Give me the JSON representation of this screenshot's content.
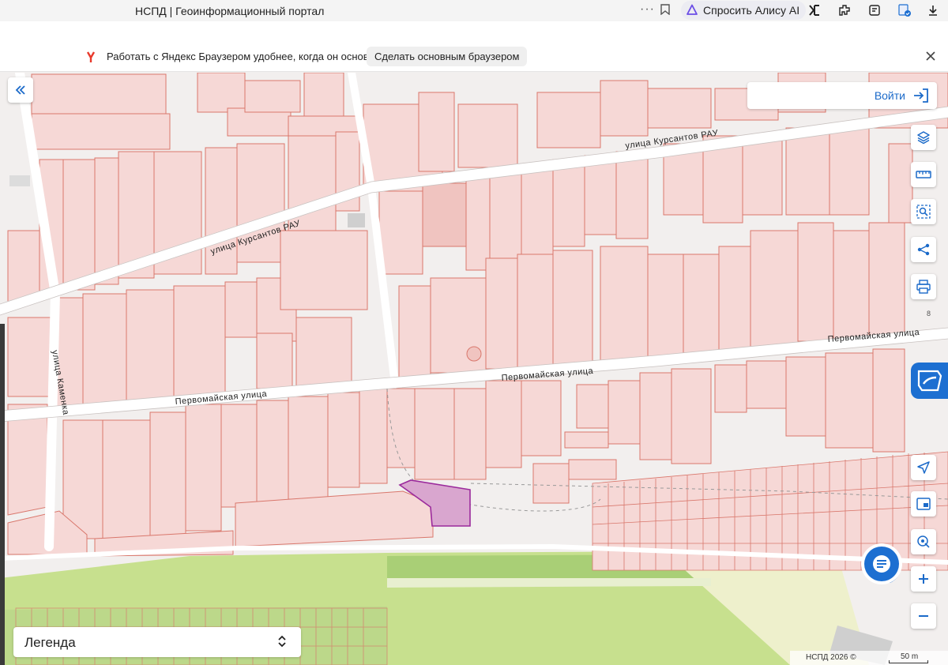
{
  "browser": {
    "tab_title": "НСПД | Геоинформационный портал",
    "menu_dots": "···",
    "alice_label": "Спросить Алису AI"
  },
  "infobar": {
    "message": "Работать с Яндекс Браузером удобнее, когда он основной",
    "make_default_label": "Сделать основным браузером"
  },
  "map": {
    "login_label": "Войти",
    "legend_label": "Легенда",
    "copyright": "НСПД 2026 ©",
    "scale_label": "50 m",
    "house_number": "8",
    "streets": {
      "kursantov_top": "улица Курсантов РАУ",
      "kursantov_left": "улица Курсантов РАУ",
      "pervomayskaya_left": "Первомайская улица",
      "pervomayskaya_mid": "Первомайская улица",
      "pervomayskaya_right": "Первомайская улица",
      "kamenka": "улица Каменка"
    },
    "colors": {
      "parcel_fill": "#f6d8d6",
      "parcel_stroke": "#d9776c",
      "selected_fill": "#d9a6cf",
      "selected_stroke": "#9b2a9c",
      "green_zone": "#c7e08e",
      "accent": "#1d6fd1"
    },
    "icons": [
      "collapse-left-icon",
      "login-icon",
      "layers-icon",
      "ruler-icon",
      "area-search-icon",
      "share-icon",
      "print-icon",
      "rosreestr-icon",
      "navigate-icon",
      "basemap-icon",
      "geolocation-icon",
      "zoom-in-icon",
      "zoom-out-icon",
      "chat-icon"
    ]
  }
}
